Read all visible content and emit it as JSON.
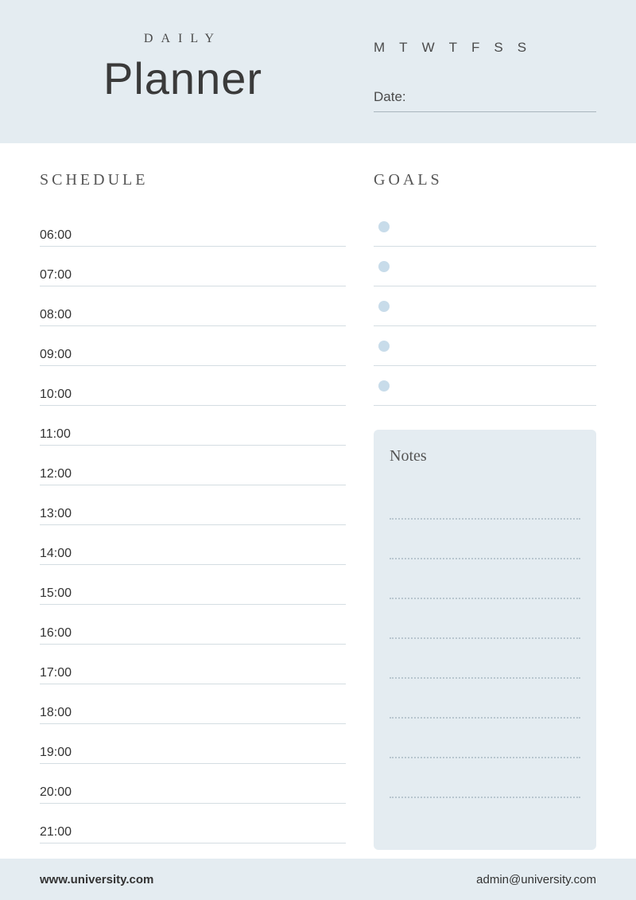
{
  "header": {
    "subtitle": "DAILY",
    "title": "Planner",
    "weekdays": [
      "M",
      "T",
      "W",
      "T",
      "F",
      "S",
      "S"
    ],
    "date_label": "Date:",
    "date_value": ""
  },
  "schedule": {
    "title": "SCHEDULE",
    "rows": [
      {
        "time": "06:00",
        "value": ""
      },
      {
        "time": "07:00",
        "value": ""
      },
      {
        "time": "08:00",
        "value": ""
      },
      {
        "time": "09:00",
        "value": ""
      },
      {
        "time": "10:00",
        "value": ""
      },
      {
        "time": "11:00",
        "value": ""
      },
      {
        "time": "12:00",
        "value": ""
      },
      {
        "time": "13:00",
        "value": ""
      },
      {
        "time": "14:00",
        "value": ""
      },
      {
        "time": "15:00",
        "value": ""
      },
      {
        "time": "16:00",
        "value": ""
      },
      {
        "time": "17:00",
        "value": ""
      },
      {
        "time": "18:00",
        "value": ""
      },
      {
        "time": "19:00",
        "value": ""
      },
      {
        "time": "20:00",
        "value": ""
      },
      {
        "time": "21:00",
        "value": ""
      }
    ]
  },
  "goals": {
    "title": "GOALS",
    "items": [
      {
        "value": ""
      },
      {
        "value": ""
      },
      {
        "value": ""
      },
      {
        "value": ""
      },
      {
        "value": ""
      }
    ]
  },
  "notes": {
    "title": "Notes",
    "lines": [
      {
        "value": ""
      },
      {
        "value": ""
      },
      {
        "value": ""
      },
      {
        "value": ""
      },
      {
        "value": ""
      },
      {
        "value": ""
      },
      {
        "value": ""
      },
      {
        "value": ""
      }
    ]
  },
  "footer": {
    "website": "www.university.com",
    "email": "admin@university.com"
  }
}
